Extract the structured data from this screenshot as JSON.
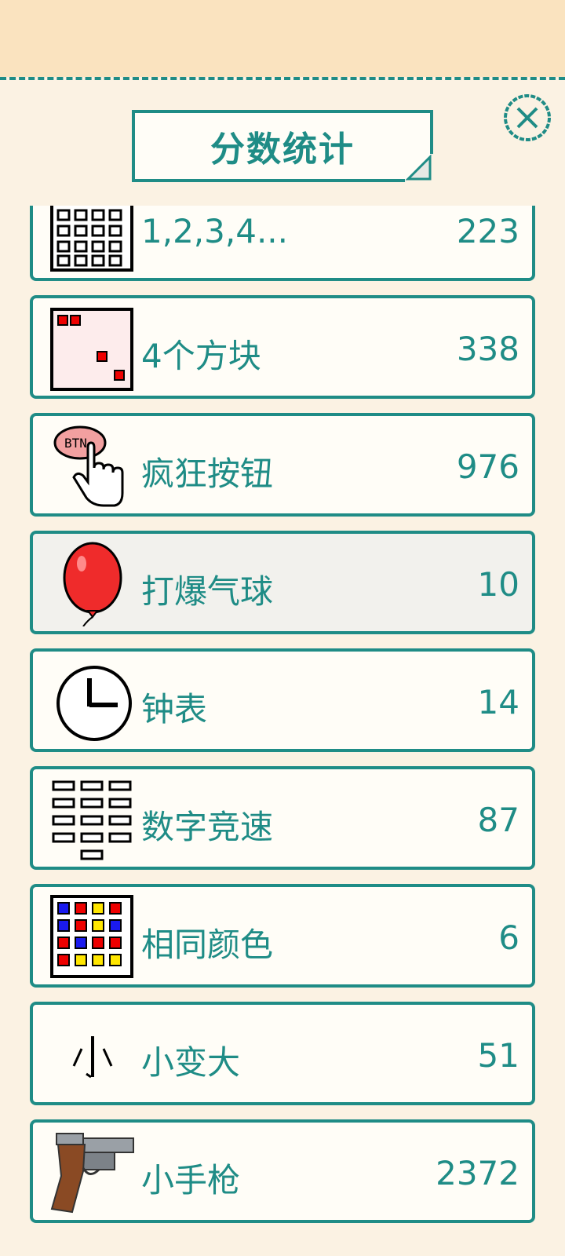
{
  "header": {
    "title": "分数统计"
  },
  "icons": {
    "close": "close-x-icon"
  },
  "colors": {
    "accent": "#1f8c86",
    "background": "#fae3bf",
    "panel": "#fbf2e3",
    "row": "#fffdf7"
  },
  "games": [
    {
      "name": "1,2,3,4...",
      "score": "223",
      "icon": "number-grid-icon"
    },
    {
      "name": "4个方块",
      "score": "338",
      "icon": "four-squares-icon"
    },
    {
      "name": "疯狂按钮",
      "score": "976",
      "icon": "crazy-button-icon"
    },
    {
      "name": "打爆气球",
      "score": "10",
      "icon": "balloon-icon"
    },
    {
      "name": "钟表",
      "score": "14",
      "icon": "clock-icon"
    },
    {
      "name": "数字竞速",
      "score": "87",
      "icon": "number-race-icon"
    },
    {
      "name": "相同颜色",
      "score": "6",
      "icon": "color-grid-icon"
    },
    {
      "name": "小变大",
      "score": "51",
      "icon": "small-to-big-icon"
    },
    {
      "name": "小手枪",
      "score": "2372",
      "icon": "pistol-icon"
    }
  ]
}
